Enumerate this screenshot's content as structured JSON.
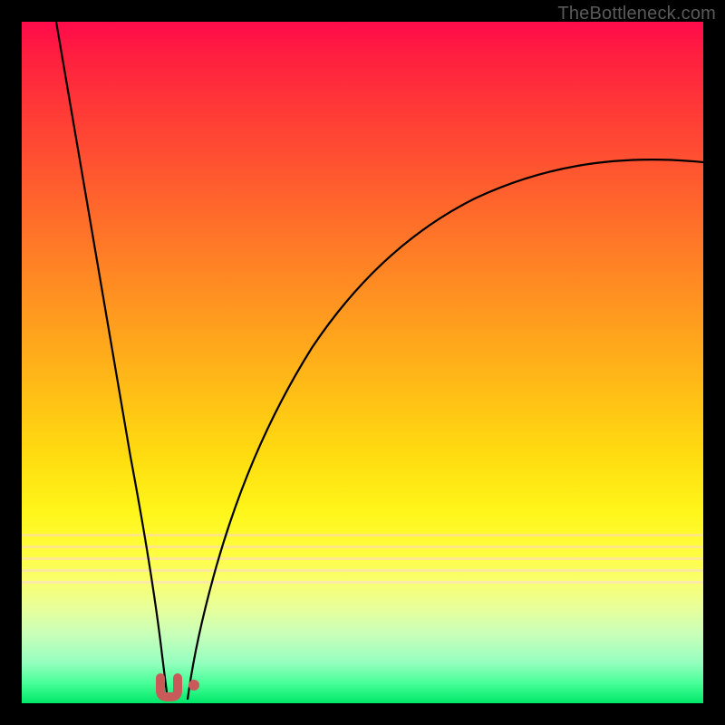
{
  "watermark": "TheBottleneck.com",
  "chart_data": {
    "type": "line",
    "title": "",
    "xlabel": "",
    "ylabel": "",
    "x_range": [
      0,
      100
    ],
    "y_range": [
      0,
      100
    ],
    "grid": false,
    "legend": false,
    "series": [
      {
        "name": "left-curve",
        "x": [
          5,
          7.5,
          10,
          12.5,
          15,
          17.5,
          19,
          20,
          20.8,
          21.3
        ],
        "y": [
          100,
          78,
          58,
          40,
          25,
          12,
          5,
          2,
          1,
          0.5
        ]
      },
      {
        "name": "right-curve",
        "x": [
          24,
          25,
          27,
          30,
          34,
          39,
          45,
          52,
          60,
          70,
          82,
          95,
          100
        ],
        "y": [
          0.5,
          2,
          6,
          13,
          22,
          32,
          42,
          51,
          59,
          66,
          72,
          77,
          79
        ]
      },
      {
        "name": "u-marker",
        "x": [
          20.3,
          20.3,
          20.8,
          21.7,
          22.3,
          22.3
        ],
        "y": [
          3.2,
          1.4,
          0.7,
          0.7,
          1.4,
          3.2
        ]
      },
      {
        "name": "dot-marker",
        "x": [
          25.1
        ],
        "y": [
          2.0
        ]
      }
    ],
    "gradient_color_stops": [
      {
        "pos": 0,
        "color": "#ff0b4b"
      },
      {
        "pos": 0.5,
        "color": "#ffbd16"
      },
      {
        "pos": 0.8,
        "color": "#fffd40"
      },
      {
        "pos": 1.0,
        "color": "#00e86a"
      }
    ],
    "marker_color": "#c85a5a"
  }
}
